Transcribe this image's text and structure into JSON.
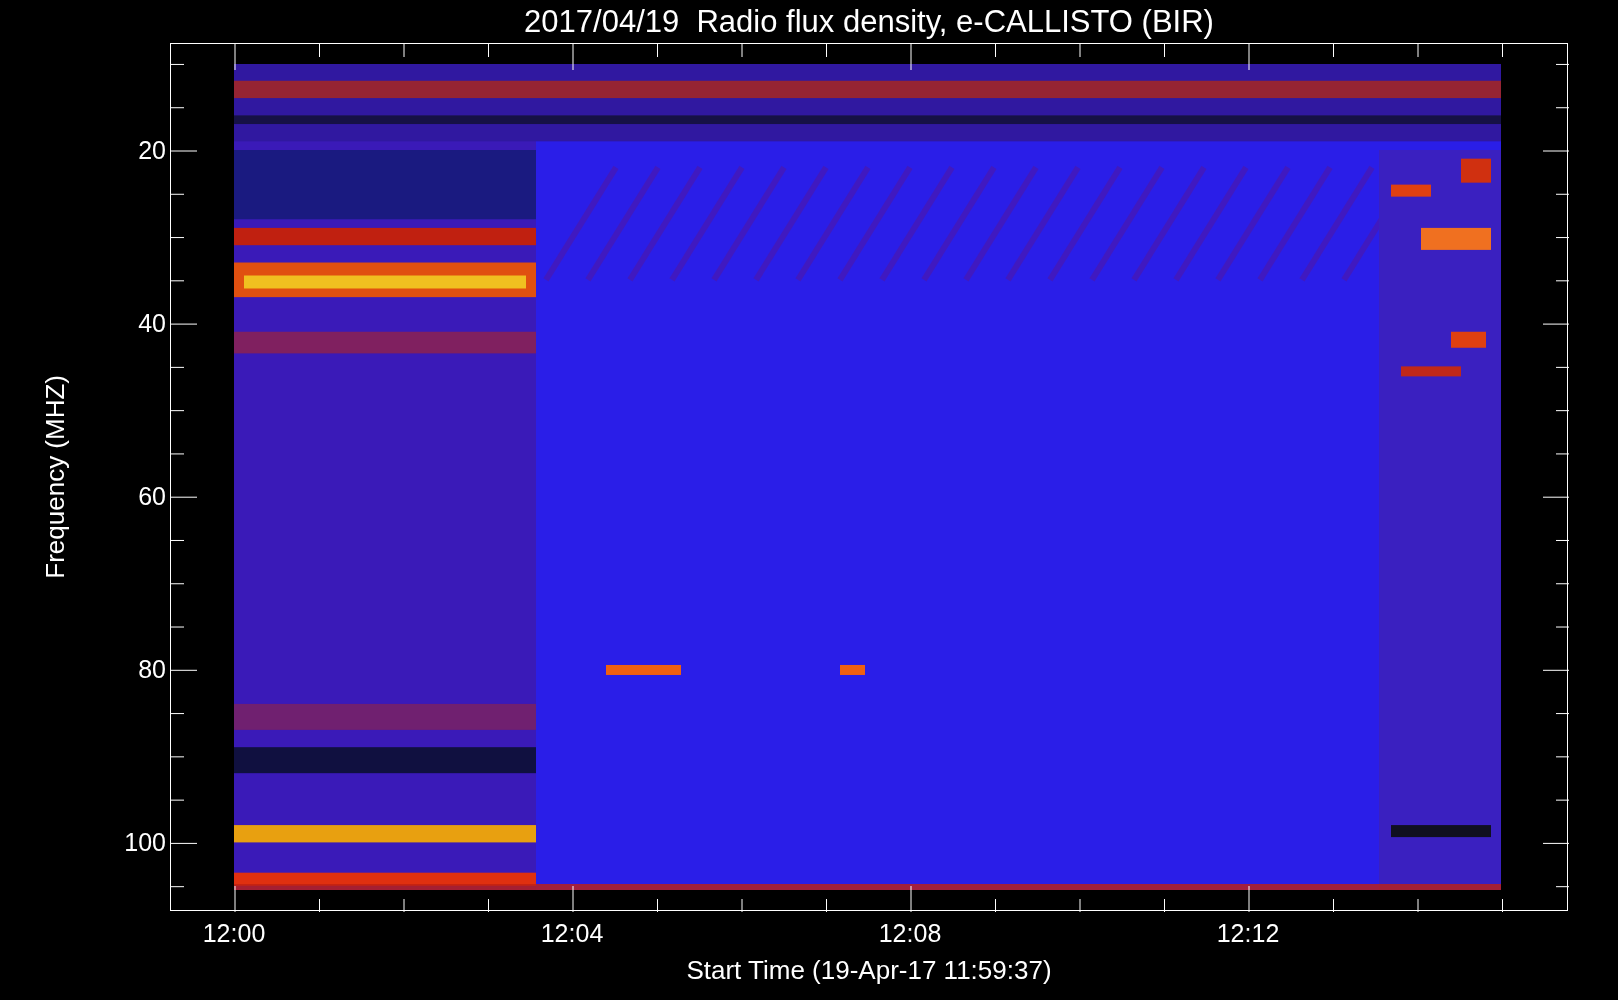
{
  "title": "2017/04/19  Radio flux density, e-CALLISTO (BIR)",
  "y_axis": {
    "label": "Frequency (MHZ)",
    "ticks": [
      "20",
      "40",
      "60",
      "80",
      "100"
    ]
  },
  "x_axis": {
    "label": "Start Time (19-Apr-17 11:59:37)",
    "ticks": [
      "12:00",
      "12:04",
      "12:08",
      "12:12"
    ]
  }
}
